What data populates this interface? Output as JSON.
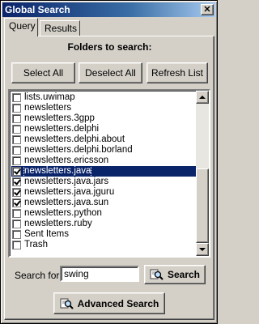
{
  "window": {
    "title": "Global Search",
    "close_glyph": "✕"
  },
  "tabs": [
    {
      "label": "Query",
      "active": true
    },
    {
      "label": "Results",
      "active": false
    }
  ],
  "folders": {
    "title": "Folders to search:",
    "buttons": {
      "select_all": "Select All",
      "deselect_all": "Deselect All",
      "refresh": "Refresh List"
    },
    "items": [
      {
        "label": "lists.uwimap",
        "checked": false,
        "selected": false
      },
      {
        "label": "newsletters",
        "checked": false,
        "selected": false
      },
      {
        "label": "newsletters.3gpp",
        "checked": false,
        "selected": false
      },
      {
        "label": "newsletters.delphi",
        "checked": false,
        "selected": false
      },
      {
        "label": "newsletters.delphi.about",
        "checked": false,
        "selected": false
      },
      {
        "label": "newsletters.delphi.borland",
        "checked": false,
        "selected": false
      },
      {
        "label": "newsletters.ericsson",
        "checked": false,
        "selected": false
      },
      {
        "label": "newsletters.java",
        "checked": true,
        "selected": true
      },
      {
        "label": "newsletters.java.jars",
        "checked": true,
        "selected": false
      },
      {
        "label": "newsletters.java.jguru",
        "checked": true,
        "selected": false
      },
      {
        "label": "newsletters.java.sun",
        "checked": true,
        "selected": false
      },
      {
        "label": "newsletters.python",
        "checked": false,
        "selected": false
      },
      {
        "label": "newsletters.ruby",
        "checked": false,
        "selected": false
      },
      {
        "label": "Sent Items",
        "checked": false,
        "selected": false
      },
      {
        "label": "Trash",
        "checked": false,
        "selected": false
      }
    ]
  },
  "search": {
    "label": "Search for",
    "value": "swing",
    "button": "Search"
  },
  "advanced": {
    "button": "Advanced Search"
  },
  "colors": {
    "titlebar": "#0a246a",
    "selection": "#0a246a",
    "face": "#d4d0c8"
  }
}
